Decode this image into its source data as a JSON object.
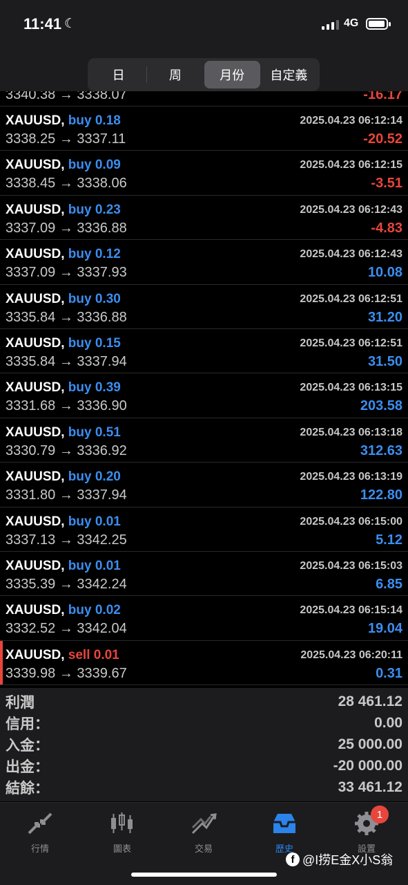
{
  "status": {
    "time": "11:41",
    "network": "4G"
  },
  "segments": [
    {
      "label": "日",
      "active": false
    },
    {
      "label": "周",
      "active": false
    },
    {
      "label": "月份",
      "active": true
    },
    {
      "label": "自定義",
      "active": false
    }
  ],
  "partial_row": {
    "prices": "3340.38 → 3338.07",
    "profit": "-16.17"
  },
  "trades": [
    {
      "symbol": "XAUUSD,",
      "side": "buy 0.18",
      "date": "2025.04.23 06:12:14",
      "prices": "3338.25 → 3337.11",
      "profit": "-20.52"
    },
    {
      "symbol": "XAUUSD,",
      "side": "buy 0.09",
      "date": "2025.04.23 06:12:15",
      "prices": "3338.45 → 3338.06",
      "profit": "-3.51"
    },
    {
      "symbol": "XAUUSD,",
      "side": "buy 0.23",
      "date": "2025.04.23 06:12:43",
      "prices": "3337.09 → 3336.88",
      "profit": "-4.83"
    },
    {
      "symbol": "XAUUSD,",
      "side": "buy 0.12",
      "date": "2025.04.23 06:12:43",
      "prices": "3337.09 → 3337.93",
      "profit": "10.08"
    },
    {
      "symbol": "XAUUSD,",
      "side": "buy 0.30",
      "date": "2025.04.23 06:12:51",
      "prices": "3335.84 → 3336.88",
      "profit": "31.20"
    },
    {
      "symbol": "XAUUSD,",
      "side": "buy 0.15",
      "date": "2025.04.23 06:12:51",
      "prices": "3335.84 → 3337.94",
      "profit": "31.50"
    },
    {
      "symbol": "XAUUSD,",
      "side": "buy 0.39",
      "date": "2025.04.23 06:13:15",
      "prices": "3331.68 → 3336.90",
      "profit": "203.58"
    },
    {
      "symbol": "XAUUSD,",
      "side": "buy 0.51",
      "date": "2025.04.23 06:13:18",
      "prices": "3330.79 → 3336.92",
      "profit": "312.63"
    },
    {
      "symbol": "XAUUSD,",
      "side": "buy 0.20",
      "date": "2025.04.23 06:13:19",
      "prices": "3331.80 → 3337.94",
      "profit": "122.80"
    },
    {
      "symbol": "XAUUSD,",
      "side": "buy 0.01",
      "date": "2025.04.23 06:15:00",
      "prices": "3337.13 → 3342.25",
      "profit": "5.12"
    },
    {
      "symbol": "XAUUSD,",
      "side": "buy 0.01",
      "date": "2025.04.23 06:15:03",
      "prices": "3335.39 → 3342.24",
      "profit": "6.85"
    },
    {
      "symbol": "XAUUSD,",
      "side": "buy 0.02",
      "date": "2025.04.23 06:15:14",
      "prices": "3332.52 → 3342.04",
      "profit": "19.04"
    },
    {
      "symbol": "XAUUSD,",
      "side": "sell 0.01",
      "date": "2025.04.23 06:20:11",
      "prices": "3339.98 → 3339.67",
      "profit": "0.31"
    }
  ],
  "summary": [
    {
      "label": "利潤",
      "value": "28 461.12"
    },
    {
      "label": "信用：",
      "value": "0.00"
    },
    {
      "label": "入金：",
      "value": "25 000.00"
    },
    {
      "label": "出金：",
      "value": "-20 000.00"
    },
    {
      "label": "結餘：",
      "value": "33 461.12"
    }
  ],
  "tabs": [
    {
      "label": "行情",
      "icon": "quotes-icon",
      "active": false
    },
    {
      "label": "圖表",
      "icon": "chart-icon",
      "active": false
    },
    {
      "label": "交易",
      "icon": "trade-icon",
      "active": false
    },
    {
      "label": "歷史",
      "icon": "history-icon",
      "active": true
    },
    {
      "label": "設置",
      "icon": "settings-icon",
      "active": false,
      "badge": "1"
    }
  ],
  "watermark": {
    "fb": "f",
    "text": "@I捞E金X小S翁"
  },
  "colors": {
    "buy": "#3b8ef0",
    "sell": "#e8463c",
    "accent": "#2a84ea"
  }
}
